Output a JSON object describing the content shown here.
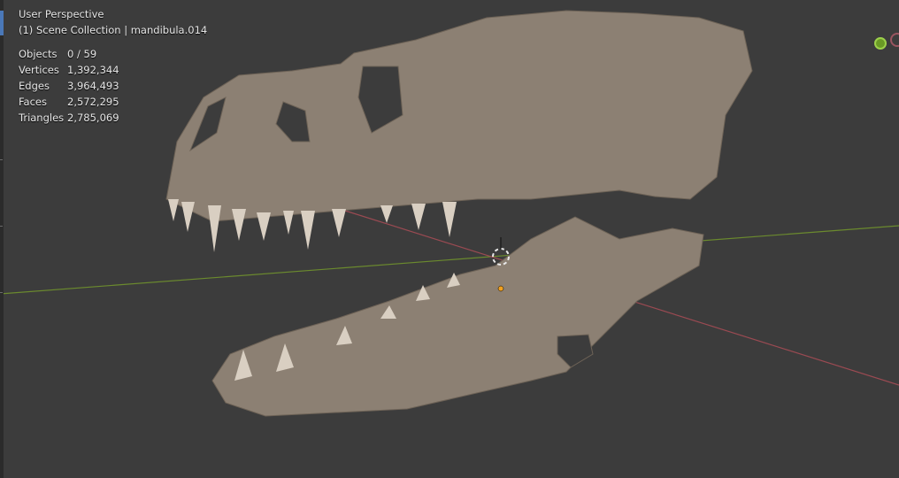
{
  "viewport": {
    "view_name": "User Perspective",
    "collection_info": "(1) Scene Collection | mandibula.014",
    "stats": [
      {
        "label": "Objects",
        "value": "0 / 59"
      },
      {
        "label": "Vertices",
        "value": "1,392,344"
      },
      {
        "label": "Edges",
        "value": "3,964,493"
      },
      {
        "label": "Faces",
        "value": "2,572,295"
      },
      {
        "label": "Triangles",
        "value": "2,785,069"
      }
    ]
  },
  "colors": {
    "background": "#3c3c3c",
    "model": "#8c8073",
    "x_axis": "#9a4a52",
    "y_axis": "#6b8a2e"
  }
}
